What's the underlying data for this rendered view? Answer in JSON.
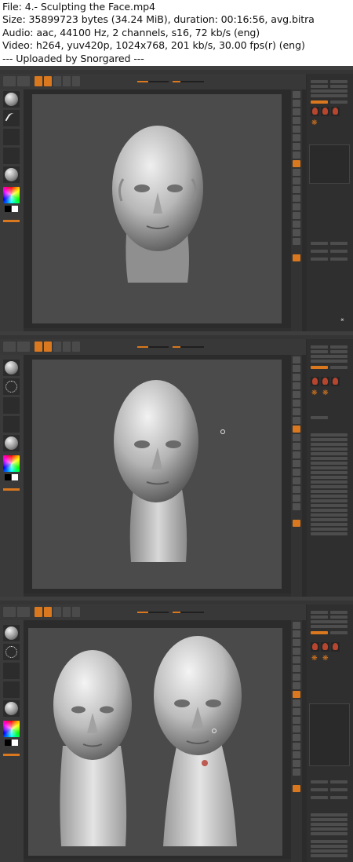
{
  "file_info": {
    "line1": "File: 4.- Sculpting the Face.mp4",
    "line2": "Size: 35899723 bytes (34.24 MiB), duration: 00:16:56, avg.bitra",
    "line3": "Audio: aac, 44100 Hz, 2 channels, s16, 72 kb/s (eng)",
    "line4": "Video: h264, yuv420p, 1024x768, 201 kb/s, 30.00 fps(r) (eng)",
    "line5": "--- Uploaded by Snorgared ---"
  },
  "colors": {
    "accent": "#d9781f",
    "viewport": "#4b4b4b",
    "ui_dark": "#2b2b2b"
  },
  "icons": {
    "brush": "sphere-brush-icon",
    "stroke": "stroke-icon",
    "alpha": "alpha-icon",
    "material": "material-sphere-icon",
    "color": "color-picker-icon",
    "gizmo": "axis-gizmo-icon"
  }
}
